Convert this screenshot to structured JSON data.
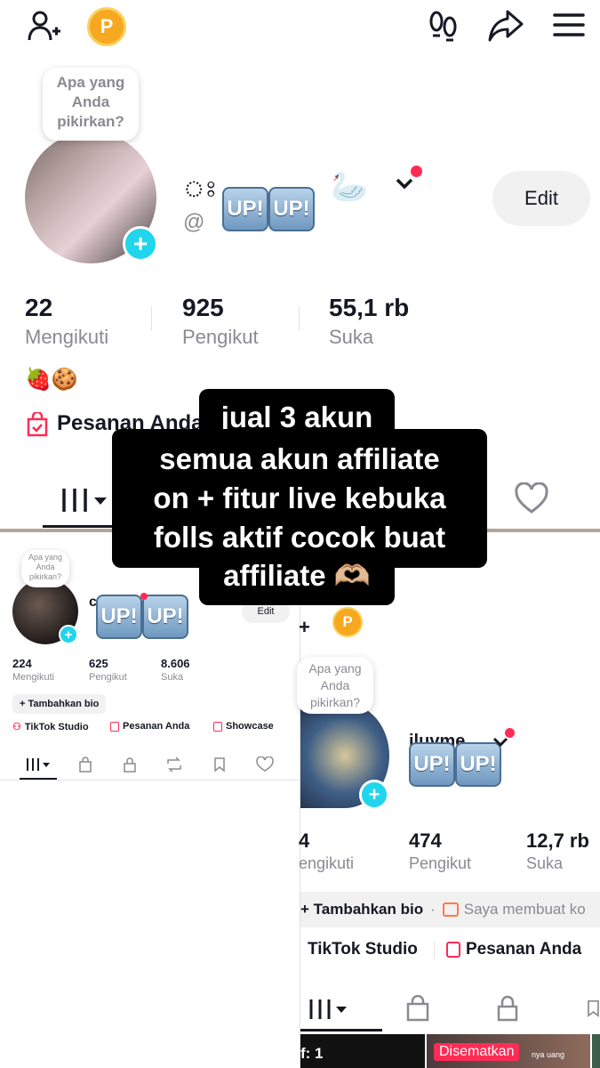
{
  "top": {
    "add_user_icon": "add-friend-icon",
    "points_badge": "P",
    "icons": [
      "footprint-icon",
      "share-icon",
      "menu-icon"
    ]
  },
  "main": {
    "thought_bubble": "Apa yang Anda pikirkan?",
    "name_prefix": "ঃ",
    "handle_prefix": "@",
    "up1": "UP!",
    "up2": "UP!",
    "swan": "🦢",
    "edit_button": "Edit",
    "stats": [
      {
        "num": "22",
        "label": "Mengikuti"
      },
      {
        "num": "925",
        "label": "Pengikut"
      },
      {
        "num": "55,1 rb",
        "label": "Suka"
      }
    ],
    "bio_emoji": "🍓🍪",
    "orders_label": "Pesanan Anda"
  },
  "caption": {
    "line1": "jual 3 akun",
    "line2": "semua akun affiliate",
    "line3": "on + fitur live kebuka",
    "line4": "folls aktif cocok buat",
    "line5": "affiliate 🫶🏼"
  },
  "left": {
    "thought_bubble": "Apa yang Anda pikirkan?",
    "name_prefix": "c",
    "up1": "UP!",
    "up2": "UP!",
    "edit_button": "Edit",
    "stats": [
      {
        "num": "224",
        "label": "Mengikuti"
      },
      {
        "num": "625",
        "label": "Pengikut"
      },
      {
        "num": "8.606",
        "label": "Suka"
      }
    ],
    "add_bio": "+ Tambahkan bio",
    "studio": "TikTok Studio",
    "orders": "Pesanan Anda",
    "showcase": "Showcase"
  },
  "right": {
    "points_badge": "P",
    "plus_icon": "+",
    "thought_bubble": "Apa yang Anda pikirkan?",
    "name": "iluvme",
    "up1": "UP!",
    "up2": "UP!",
    "stats": [
      {
        "num": "4",
        "label": "engikuti"
      },
      {
        "num": "474",
        "label": "Pengikut"
      },
      {
        "num": "12,7 rb",
        "label": "Suka"
      }
    ],
    "add_bio": "+ Tambahkan bio",
    "bio_dot": "·",
    "creator_link": "Saya membuat ko",
    "studio": "TikTok Studio",
    "orders": "Pesanan Anda",
    "video_count": "f: 1",
    "pinned": "Disematkan",
    "video_text": "nya uang"
  }
}
